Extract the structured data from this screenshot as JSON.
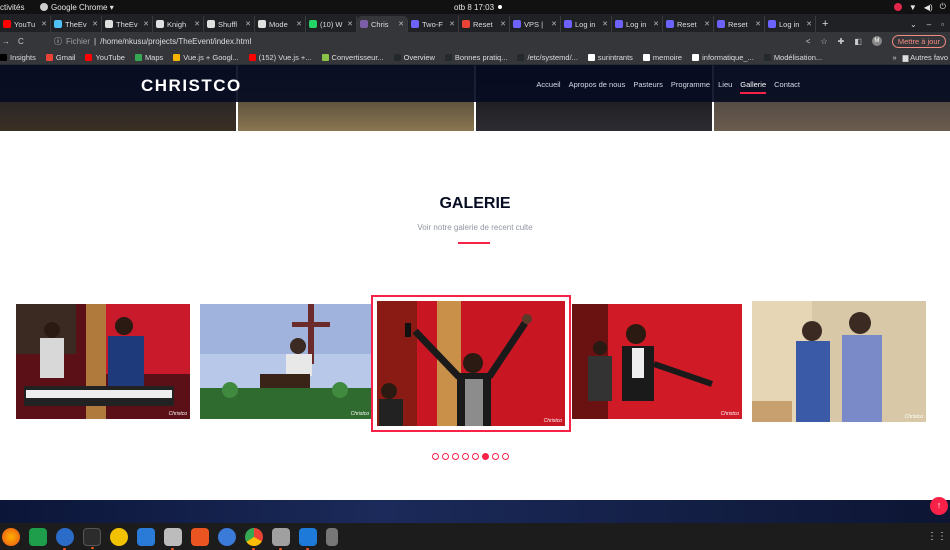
{
  "system_bar": {
    "activities": "ctivités",
    "app_name": "Google Chrome ▾",
    "clock": "otb 8  17:03"
  },
  "tabs": [
    {
      "title": "YouTu",
      "color": "#ff0000"
    },
    {
      "title": "TheEv",
      "color": "#4fc3f7"
    },
    {
      "title": "TheEv",
      "color": "#e0e0e0"
    },
    {
      "title": "Knigh",
      "color": "#e0e0e0"
    },
    {
      "title": "Shuffl",
      "color": "#e0e0e0"
    },
    {
      "title": "Mode",
      "color": "#e0e0e0"
    },
    {
      "title": "(10) W",
      "color": "#25d366"
    },
    {
      "title": "Chris",
      "color": "#7b5ea7",
      "active": true
    },
    {
      "title": "Two-F",
      "color": "#6c63ff"
    },
    {
      "title": "Reset",
      "color": "#ea4335"
    },
    {
      "title": "VPS |",
      "color": "#6c63ff"
    },
    {
      "title": "Log in",
      "color": "#6c63ff"
    },
    {
      "title": "Log in",
      "color": "#6c63ff"
    },
    {
      "title": "Reset",
      "color": "#6c63ff"
    },
    {
      "title": "Reset",
      "color": "#6c63ff"
    },
    {
      "title": "Log in",
      "color": "#6c63ff"
    }
  ],
  "toolbar": {
    "scheme": "Fichier",
    "url": "/home/nkusu/projects/TheEvent/index.html",
    "profile": "M",
    "update_label": "Mettre à jour"
  },
  "bookmarks": [
    {
      "label": "Insights",
      "color": "#000000"
    },
    {
      "label": "Gmail",
      "color": "#ea4335"
    },
    {
      "label": "YouTube",
      "color": "#ff0000"
    },
    {
      "label": "Maps",
      "color": "#34a853"
    },
    {
      "label": "Vue.js + Googl...",
      "color": "#f4b400"
    },
    {
      "label": "(152) Vue.js +...",
      "color": "#ff0000"
    },
    {
      "label": "Convertisseur...",
      "color": "#8bc34a"
    },
    {
      "label": "Overview",
      "color": "#24292e"
    },
    {
      "label": "Bonnes pratiq...",
      "color": "#24292e"
    },
    {
      "label": "/etc/systemd/...",
      "color": "#24292e"
    },
    {
      "label": "surintrants",
      "color": "#ffffff"
    },
    {
      "label": "memoire",
      "color": "#ffffff"
    },
    {
      "label": "informatique_...",
      "color": "#ffffff"
    },
    {
      "label": "Modélisation...",
      "color": "#24292e"
    }
  ],
  "bookmarks_more": "»",
  "bookmarks_other": "Autres favo",
  "site": {
    "brand": "CHRISTCO",
    "menu": [
      "Accueil",
      "Apropos de nous",
      "Pasteurs",
      "Programme",
      "Lieu",
      "Gallerie",
      "Contact"
    ],
    "active_menu": "Gallerie",
    "accent": "#f82249",
    "navy": "#060c22"
  },
  "gallery": {
    "title": "GALERIE",
    "subtitle": "Voir notre galerie de recent culte",
    "watermark": "Christco",
    "active_dot": 5,
    "dot_count": 8
  },
  "back_to_top": "↑"
}
